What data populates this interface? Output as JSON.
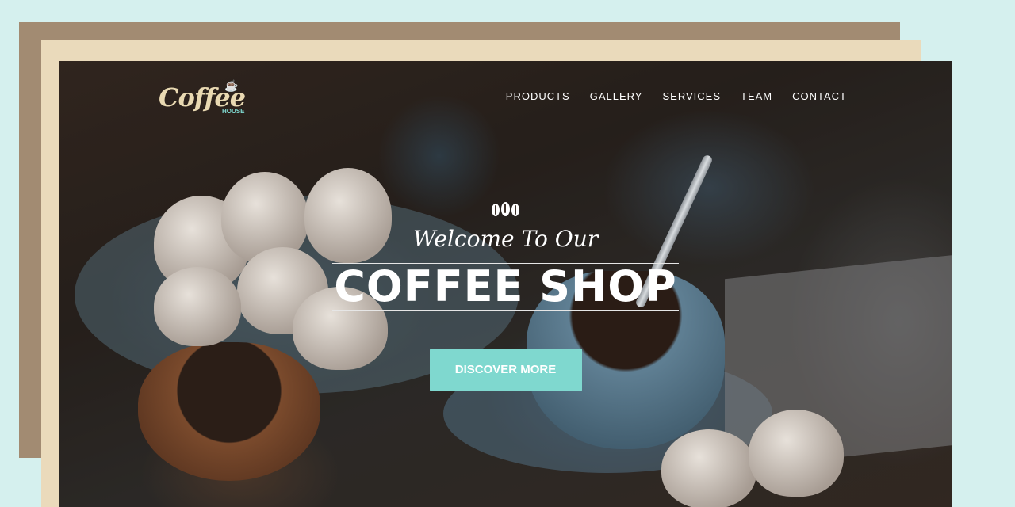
{
  "brand": {
    "logo_text": "Coffee",
    "logo_sub": "HOUSE",
    "logo_icon": "cup-icon"
  },
  "nav": {
    "items": [
      "PRODUCTS",
      "GALLERY",
      "SERVICES",
      "TEAM",
      "CONTACT"
    ]
  },
  "hero": {
    "welcome": "Welcome To Our",
    "title": "COFFEE SHOP",
    "cta_label": "DISCOVER MORE",
    "icon": "coffee-beans-icon"
  },
  "colors": {
    "page_bg": "#d5f0ee",
    "layer_back": "#a28b72",
    "layer_mid": "#eadabb",
    "accent": "#7fd8cf"
  }
}
